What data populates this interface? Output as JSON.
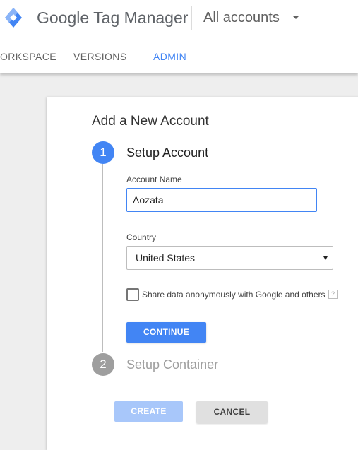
{
  "header": {
    "brand": {
      "google": "Google",
      "product": "Tag Manager"
    },
    "account_switcher": {
      "label": "All accounts"
    },
    "tabs": [
      {
        "label": "ORKSPACE",
        "active": false
      },
      {
        "label": "VERSIONS",
        "active": false
      },
      {
        "label": "ADMIN",
        "active": true
      }
    ]
  },
  "form": {
    "title": "Add a New Account",
    "steps": [
      {
        "number": "1",
        "title": "Setup Account",
        "active": true
      },
      {
        "number": "2",
        "title": "Setup Container",
        "active": false
      }
    ],
    "account_name": {
      "label": "Account Name",
      "value": "Aozata"
    },
    "country": {
      "label": "Country",
      "value": "United States"
    },
    "share_data": {
      "label": "Share data anonymously with Google and others",
      "checked": false,
      "help": "?"
    },
    "continue_label": "CONTINUE",
    "create_label": "CREATE",
    "cancel_label": "CANCEL"
  },
  "colors": {
    "accent": "#4285f4",
    "create_disabled": "#a8c7fa",
    "step_inactive": "#9e9e9e",
    "background": "#eeeeee"
  },
  "icons": {
    "logo": "tag-manager-logo-icon",
    "account_caret": "caret-down-icon",
    "select_caret": "caret-down-icon",
    "help": "help-icon"
  }
}
